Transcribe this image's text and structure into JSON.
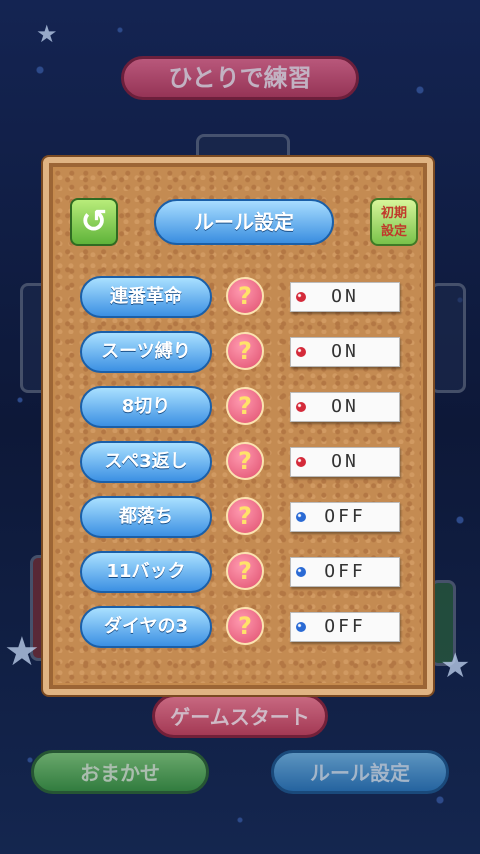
{
  "background": {
    "top_button_label": "ひとりで練習",
    "start_button_label": "ゲームスタート",
    "omakase_button_label": "おまかせ",
    "rule_button_label": "ルール設定"
  },
  "panel": {
    "back_icon": "↺",
    "title": "ルール設定",
    "reset_label_line1": "初期",
    "reset_label_line2": "設定"
  },
  "rules": [
    {
      "label": "連番革命",
      "help": "?",
      "state": "ON",
      "pin_color": "#d42a3a"
    },
    {
      "label": "スーツ縛り",
      "help": "?",
      "state": "ON",
      "pin_color": "#d42a3a"
    },
    {
      "label": "8切り",
      "help": "?",
      "state": "ON",
      "pin_color": "#d42a3a"
    },
    {
      "label": "スペ3返し",
      "help": "?",
      "state": "ON",
      "pin_color": "#d42a3a"
    },
    {
      "label": "都落ち",
      "help": "?",
      "state": "OFF",
      "pin_color": "#2a6ad4"
    },
    {
      "label": "11バック",
      "help": "?",
      "state": "OFF",
      "pin_color": "#2a6ad4"
    },
    {
      "label": "ダイヤの3",
      "help": "?",
      "state": "OFF",
      "pin_color": "#2a6ad4"
    }
  ]
}
